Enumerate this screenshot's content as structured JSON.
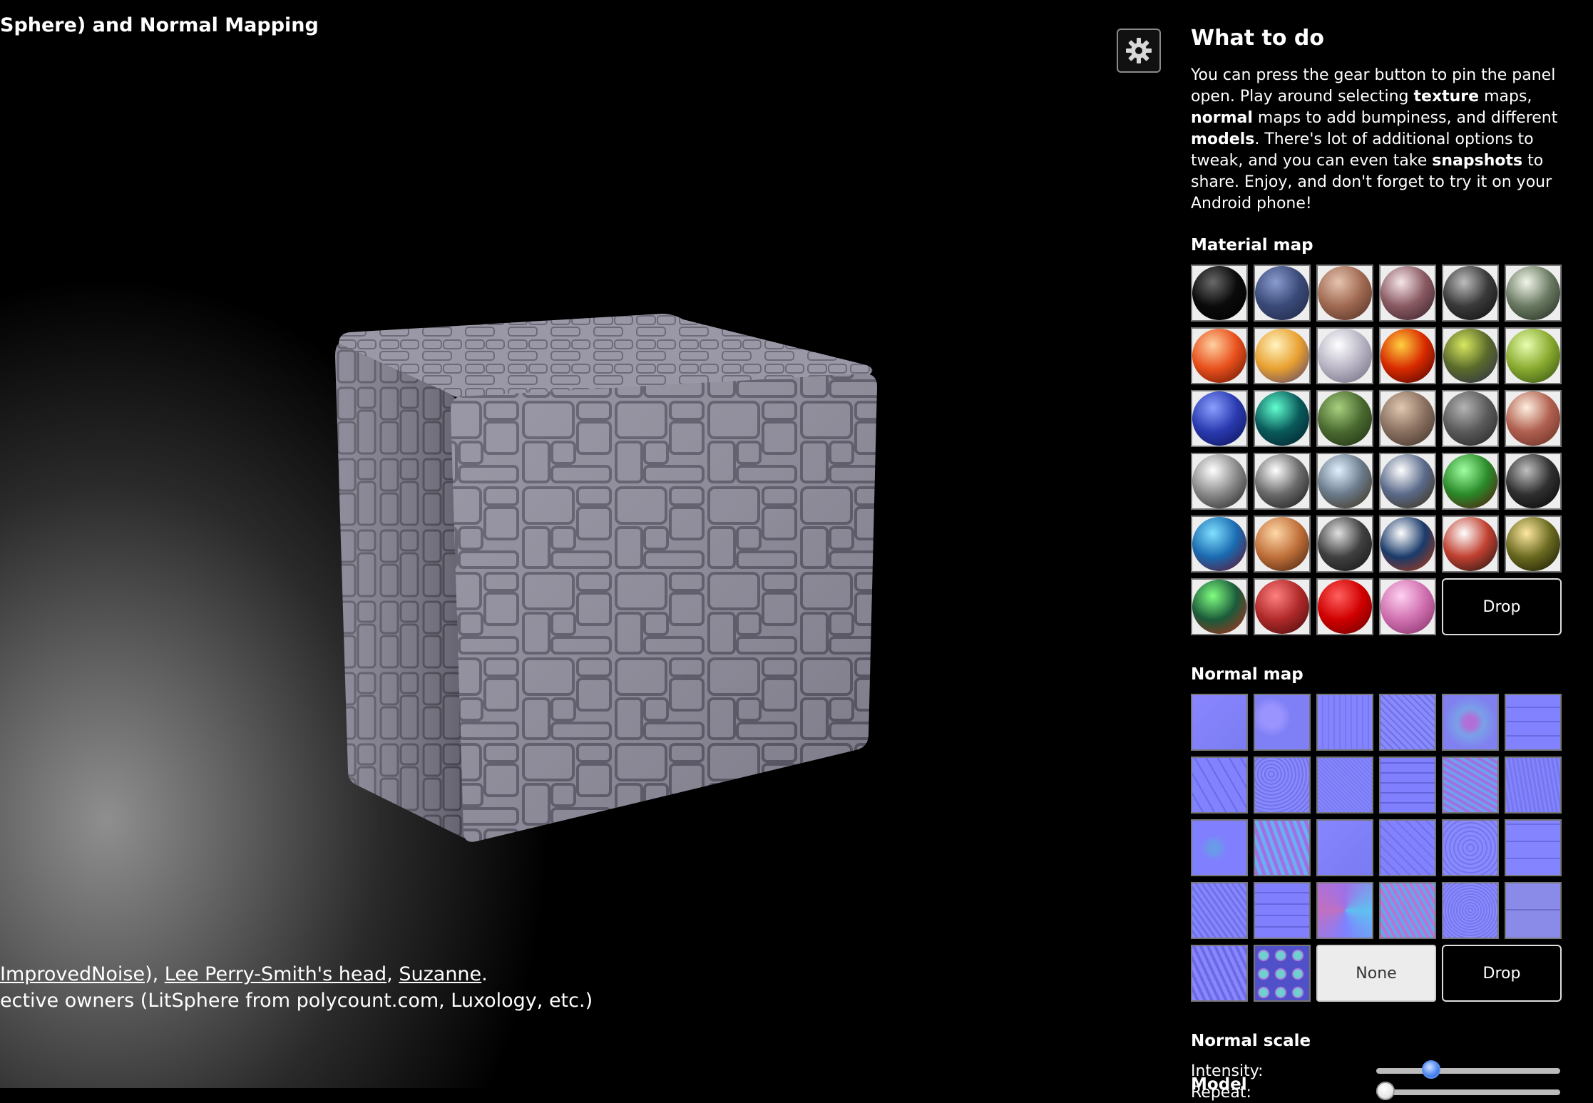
{
  "header": {
    "title": "Sphere) and Normal Mapping"
  },
  "credits": {
    "line1": [
      {
        "text": " ",
        "link": false
      },
      {
        "text": "ImprovedNoise",
        "link": true
      },
      {
        "text": "), ",
        "link": false
      },
      {
        "text": "Lee Perry-Smith's head",
        "link": true
      },
      {
        "text": ", ",
        "link": false
      },
      {
        "text": "Suzanne",
        "link": true
      },
      {
        "text": ".",
        "link": false
      }
    ],
    "line2": "ective owners (LitSphere from polycount.com, Luxology, etc.)"
  },
  "panel": {
    "heading": "What to do",
    "intro": [
      {
        "text": "You can press the gear button to pin the panel open. Play around selecting ",
        "bold": false
      },
      {
        "text": "texture",
        "bold": true
      },
      {
        "text": " maps, ",
        "bold": false
      },
      {
        "text": "normal",
        "bold": true
      },
      {
        "text": " maps to add bumpiness, and different ",
        "bold": false
      },
      {
        "text": "models",
        "bold": true
      },
      {
        "text": ". There's lot of additional options to tweak, and you can even take ",
        "bold": false
      },
      {
        "text": "snapshots",
        "bold": true
      },
      {
        "text": " to share. Enjoy, and don't forget to try it on your Android phone!",
        "bold": false
      }
    ],
    "material": {
      "label": "Material map",
      "drop_label": "Drop",
      "spheres": [
        [
          "#6a6a6a",
          "#0a0a0a",
          "#000000"
        ],
        [
          "#8a9ccf",
          "#3a4a78",
          "#1c2440"
        ],
        [
          "#e6c4b0",
          "#a06a52",
          "#4a2a20"
        ],
        [
          "#f6e6ea",
          "#8a5a62",
          "#301a24"
        ],
        [
          "#bdbdbd",
          "#3a3a3a",
          "#0a0a0a"
        ],
        [
          "#f2f6ea",
          "#6a7a62",
          "#1a2218"
        ],
        [
          "#ffd0a0",
          "#e8501c",
          "#5a1000"
        ],
        [
          "#fff4c0",
          "#e8a030",
          "#4a3a70"
        ],
        [
          "#ffffff",
          "#b8b4c4",
          "#6a6478"
        ],
        [
          "#ffd040",
          "#d82a00",
          "#400000"
        ],
        [
          "#d8e860",
          "#5a6a2a",
          "#2a2a4a"
        ],
        [
          "#e8ffb0",
          "#8aaa30",
          "#2a4a10"
        ],
        [
          "#8aa0ff",
          "#2a3ab0",
          "#0a1050"
        ],
        [
          "#60ffd0",
          "#0a5a5a",
          "#001a2a"
        ],
        [
          "#a8d080",
          "#4a6a30",
          "#1a2a10"
        ],
        [
          "#e0c8b0",
          "#8a7060",
          "#3a2c24"
        ],
        [
          "#b4b4b4",
          "#5a5a5a",
          "#202020"
        ],
        [
          "#fff0e0",
          "#b06050",
          "#602a20"
        ],
        [
          "#ffffff",
          "#8a8a8a",
          "#1a1a1a"
        ],
        [
          "#ffffff",
          "#6a6a6a",
          "#101010"
        ],
        [
          "#e0f0ff",
          "#6a7a8a",
          "#3a2a10"
        ],
        [
          "#ffffff",
          "#5a6a8a",
          "#3a2a0a"
        ],
        [
          "#a0ffa0",
          "#2a8a2a",
          "#5a0a0a"
        ],
        [
          "#c0c0c0",
          "#303030",
          "#000000"
        ],
        [
          "#80e0ff",
          "#1a6ab0",
          "#6a0a20"
        ],
        [
          "#ffd8a8",
          "#c0703a",
          "#3a1a0a"
        ],
        [
          "#e0e0e0",
          "#404040",
          "#101010"
        ],
        [
          "#ffffff",
          "#1a3a6a",
          "#c03a0a"
        ],
        [
          "#ffffff",
          "#c04030",
          "#101010"
        ],
        [
          "#ffe8a0",
          "#6a6a20",
          "#101000"
        ],
        [
          "#80ff80",
          "#1a5a3a",
          "#c02a1a"
        ],
        [
          "#ff8080",
          "#b02a2a",
          "#400808"
        ],
        [
          "#ff6060",
          "#d00000",
          "#600000"
        ],
        [
          "#ffd0f0",
          "#d070b0",
          "#7a2a60"
        ]
      ]
    },
    "normal": {
      "label": "Normal map",
      "none_label": "None",
      "drop_label": "Drop",
      "count": 26
    },
    "normal_scale": {
      "label": "Normal scale",
      "intensity_label": "Intensity:",
      "intensity_value": 0.3,
      "repeat_label": "Repeat:",
      "repeat_value": 0.05
    },
    "model_label": "Model"
  }
}
